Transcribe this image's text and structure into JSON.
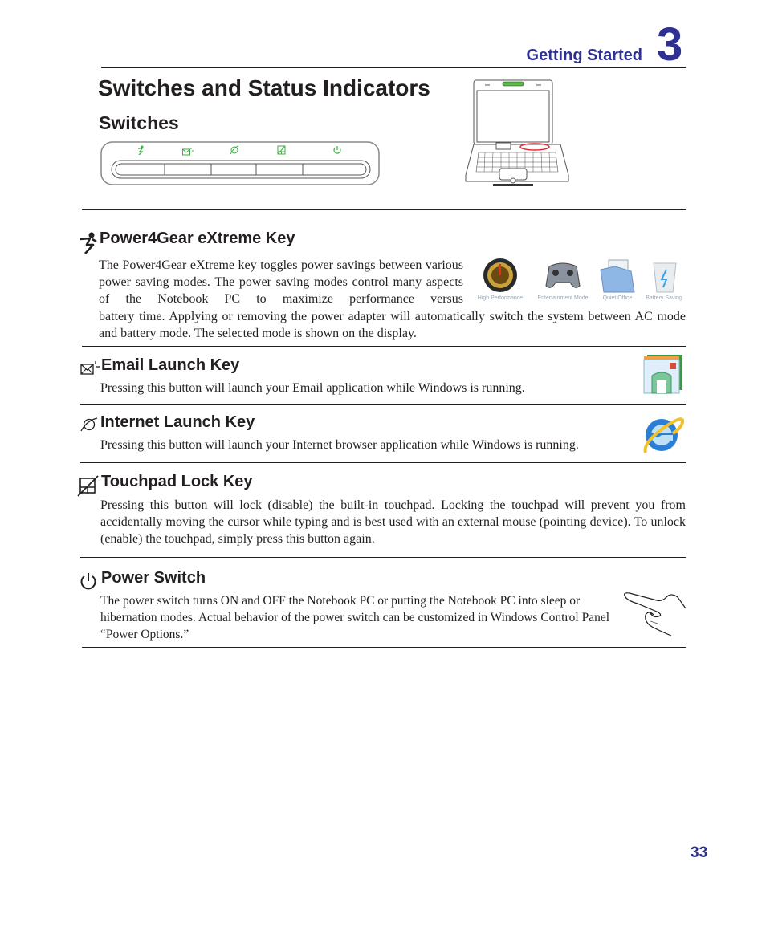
{
  "header": {
    "chapter_label": "Getting Started",
    "chapter_number": "3"
  },
  "page": {
    "title": "Switches and Status Indicators",
    "section_title": "Switches",
    "page_number": "33"
  },
  "switch_panel": {
    "icons": [
      "power4gear-icon",
      "email-icon",
      "internet-icon",
      "touchpad-lock-icon",
      "power-icon"
    ],
    "accent_color": "#3fae49"
  },
  "laptop_figure": {
    "highlight_color": "#e0262b"
  },
  "sections": [
    {
      "icon": "power4gear-icon",
      "heading": "Power4Gear eXtreme Key",
      "body_lines_narrow": "The Power4Gear eXtreme key toggles power savings between various power saving modes. The power saving modes control many aspects of the Notebook PC to maximize performance versus",
      "body_wide": "battery time. Applying or removing the power adapter will automatically switch the system between AC mode and battery mode. The selected mode is shown on the display.",
      "modes": [
        {
          "icon": "high-performance-icon",
          "label": "High Performance"
        },
        {
          "icon": "entertainment-mode-icon",
          "label": "Entertainment Mode"
        },
        {
          "icon": "quiet-office-icon",
          "label": "Quiet Office"
        },
        {
          "icon": "battery-saving-icon",
          "label": "Battery Saving"
        }
      ]
    },
    {
      "icon": "email-icon",
      "heading": "Email Launch Key",
      "body": "Pressing this button will launch your Email application while Windows is running."
    },
    {
      "icon": "internet-icon",
      "heading": "Internet Launch Key",
      "body": "Pressing this button will launch your Internet browser application while Windows is running."
    },
    {
      "icon": "touchpad-lock-icon",
      "heading": "Touchpad Lock Key",
      "body": "Pressing this button will lock (disable) the built-in touchpad. Locking the touchpad will prevent you from accidentally moving the cursor while typing and is best used with an external mouse (pointing device). To unlock (enable) the touchpad, simply press this button again."
    },
    {
      "icon": "power-icon",
      "heading": "Power Switch",
      "body": "The power switch turns ON and OFF the Notebook PC or putting the Notebook PC into sleep or hibernation modes. Actual behavior of the power switch can be customized in Windows Control Panel “Power Options.”"
    }
  ]
}
